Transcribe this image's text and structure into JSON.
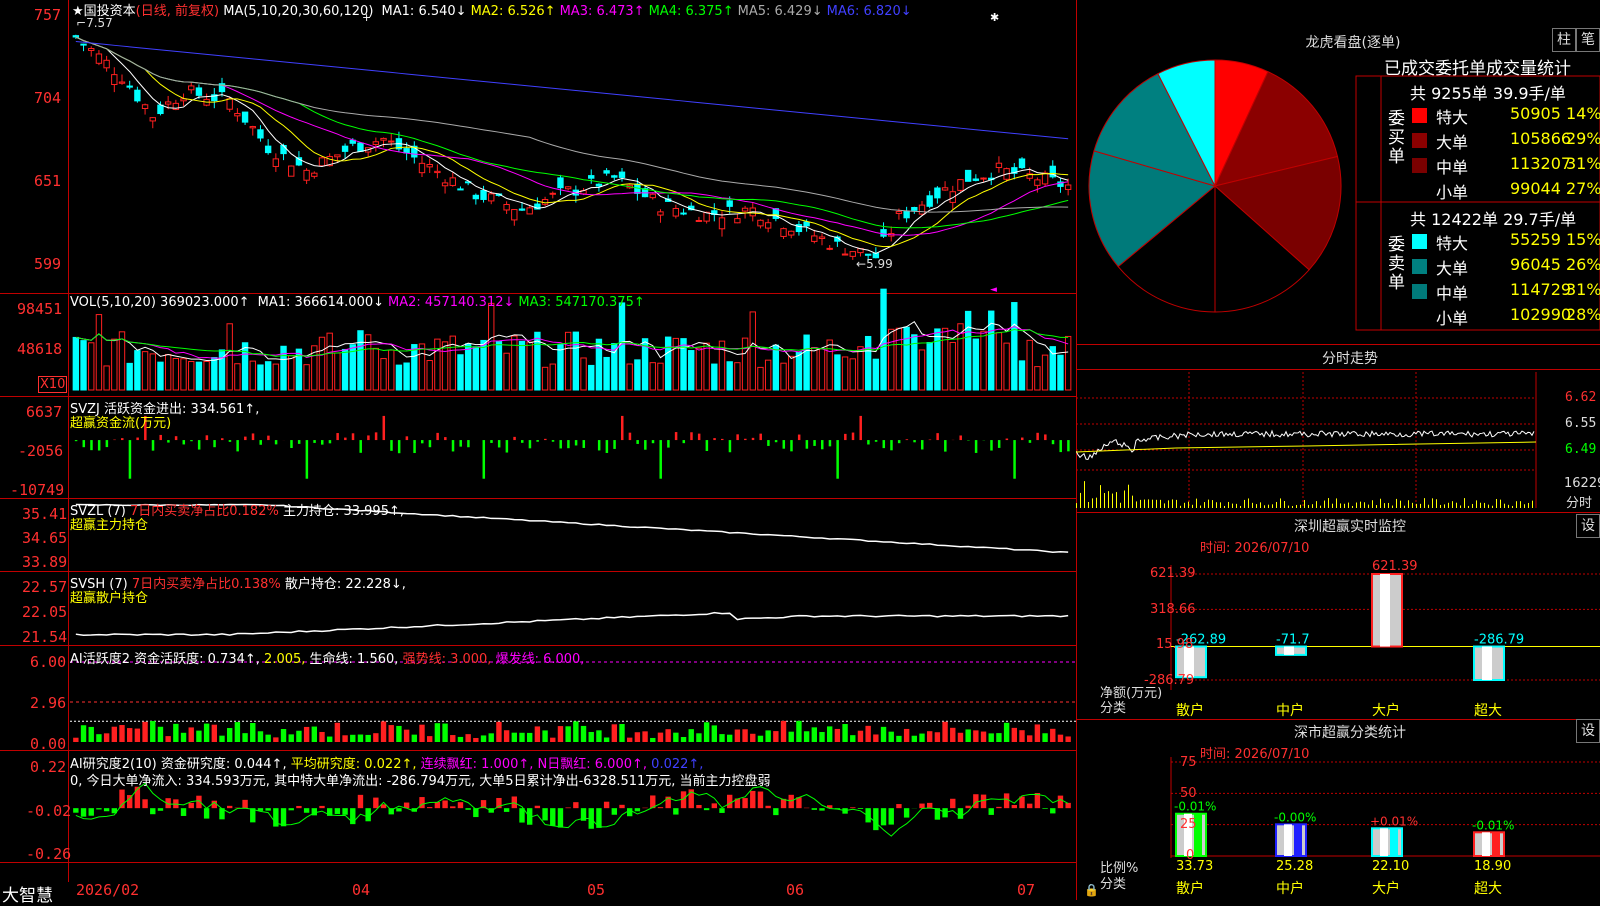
{
  "app": {
    "name": "大智慧"
  },
  "header": {
    "stock": "国投资本",
    "period": "(日线, 前复权)",
    "ma_label": "MA(5,10,20,30,60,120)",
    "ma": [
      {
        "label": "MA1: 6.540↓",
        "color": "#ffffff"
      },
      {
        "label": "MA2: 6.526↑",
        "color": "#ffff00"
      },
      {
        "label": "MA3: 6.473↑",
        "color": "#ff00ff"
      },
      {
        "label": "MA4: 6.375↑",
        "color": "#00ff00"
      },
      {
        "label": "MA5: 6.429↓",
        "color": "#aaaaaa"
      },
      {
        "label": "MA6: 6.820↓",
        "color": "#4040ff"
      }
    ]
  },
  "price_panel": {
    "y_ticks": [
      "757",
      "704",
      "651",
      "599"
    ],
    "high_label": "7.57",
    "low_label": "5.99"
  },
  "vol_panel": {
    "title": "VOL(5,10,20)",
    "value": "369023.000↑",
    "ma": [
      {
        "label": "MA1: 366614.000↓",
        "color": "#ffffff"
      },
      {
        "label": "MA2: 457140.312↓",
        "color": "#ff00ff"
      },
      {
        "label": "MA3: 547170.375↑",
        "color": "#00ff00"
      }
    ],
    "y_ticks": [
      "98451",
      "48618"
    ],
    "unit": "X10"
  },
  "svzj_panel": {
    "title": "SVZJ",
    "value_label": "活跃资金进出: 334.561↑,",
    "subtitle": "超赢资金流(万元)",
    "y_ticks": [
      "6637",
      "-2056",
      "-10749"
    ]
  },
  "svzl_panel": {
    "title": "SVZL (7)",
    "ratio": "7日内买卖净占比0.182%",
    "value_label": "主力持仓: 33.995↑,",
    "subtitle": "超赢主力持仓",
    "y_ticks": [
      "35.41",
      "34.65",
      "33.89"
    ]
  },
  "svsh_panel": {
    "title": "SVSH (7)",
    "ratio": "7日内买卖净占比0.138%",
    "value_label": "散户持仓: 22.228↓,",
    "subtitle": "超赢散户持仓",
    "y_ticks": [
      "22.57",
      "22.05",
      "21.54"
    ]
  },
  "ai_active_panel": {
    "title": "AI活跃度2",
    "l1": "资金活跃度: 0.734↑,",
    "l2": "2.005,",
    "l3": "生命线: 1.560,",
    "l4": "强势线: 3.000,",
    "l5": "爆发线: 6.000,",
    "y_ticks": [
      "6.00",
      "2.96",
      "0.00"
    ]
  },
  "ai_research_panel": {
    "title": "AI研究度2(10)",
    "l1": "资金研究度: 0.044↑,",
    "l2": "平均研究度: 0.022↑,",
    "l3": "连续飘红: 1.000↑,",
    "l4": "N日飘红: 6.000↑,",
    "l5": "0.022↑,",
    "summary": "0, 今日大单净流入: 334.593万元, 其中特大单净流出: -286.794万元, 大单5日累计净出-6328.511万元, 当前主力控盘弱",
    "y_ticks": [
      "0.22",
      "-0.02",
      "-0.26"
    ]
  },
  "x_axis": {
    "labels": [
      "2026/02",
      "04",
      "05",
      "06",
      "07"
    ]
  },
  "dragon_panel": {
    "title": "龙虎看盘(逐单)",
    "btn1": "柱",
    "btn2": "笔",
    "subtitle": "已成交委托单成交量统计",
    "buy_side": "委买单",
    "sell_side": "委卖单",
    "buy_total": "共 9255单 39.9手/单",
    "sell_total": "共 12422单 29.7手/单",
    "buy_rows": [
      {
        "label": "特大",
        "value": "50905",
        "pct": "14%",
        "color": "#ff0000"
      },
      {
        "label": "大单",
        "value": "105866",
        "pct": "29%",
        "color": "#8b0000"
      },
      {
        "label": "中单",
        "value": "113207",
        "pct": "31%",
        "color": "#7a0000"
      },
      {
        "label": "小单",
        "value": "99044",
        "pct": "27%",
        "color": "#000000"
      }
    ],
    "sell_rows": [
      {
        "label": "特大",
        "value": "55259",
        "pct": "15%",
        "color": "#00ffff"
      },
      {
        "label": "大单",
        "value": "96045",
        "pct": "26%",
        "color": "#008080"
      },
      {
        "label": "中单",
        "value": "114729",
        "pct": "31%",
        "color": "#007a7a"
      },
      {
        "label": "小单",
        "value": "102990",
        "pct": "28%",
        "color": "#000000"
      }
    ]
  },
  "intraday_panel": {
    "title": "分时走势",
    "y_ticks": [
      "6.62",
      "6.55",
      "6.49"
    ],
    "vol_label": "16229",
    "bottom_label": "分时"
  },
  "sz_monitor": {
    "title": "深圳超赢实时监控",
    "btn": "设",
    "time": "时间: 2026/07/10",
    "y_ticks": [
      "621.39",
      "318.66",
      "15.98",
      "-286.79"
    ],
    "unit1": "净额(万元)",
    "unit2": "分类",
    "categories": [
      "散户",
      "中户",
      "大户",
      "超大"
    ],
    "values": [
      "-262.89",
      "-71.7",
      "621.39",
      "-286.79"
    ]
  },
  "sz_class": {
    "title": "深市超赢分类统计",
    "btn": "设",
    "time": "时间: 2026/07/10",
    "y_ticks": [
      "75",
      "50",
      "25",
      "0"
    ],
    "unit1": "比例%",
    "unit2": "分类",
    "categories": [
      "散户",
      "中户",
      "大户",
      "超大"
    ],
    "changes": [
      "-0.01%",
      "-0.00%",
      "+0.01%",
      "-0.01%"
    ],
    "values": [
      "33.73",
      "25.28",
      "22.10",
      "18.90"
    ]
  },
  "chart_data": [
    {
      "type": "candlestick",
      "title": "国投资本",
      "ylim": [
        5.99,
        7.57
      ],
      "y_ticks": [
        7.57,
        7.04,
        6.51,
        5.99
      ],
      "x_labels": [
        "2026/02",
        "04",
        "05",
        "06",
        "07"
      ],
      "high": 7.57,
      "low": 5.99,
      "ma_last": {
        "MA1": 6.54,
        "MA2": 6.526,
        "MA3": 6.473,
        "MA4": 6.375,
        "MA5": 6.429,
        "MA6": 6.82
      }
    },
    {
      "type": "bar",
      "title": "VOL(5,10,20)",
      "y_ticks": [
        98451,
        48618
      ],
      "last": 369023.0,
      "ma_last": {
        "MA1": 366614.0,
        "MA2": 457140.312,
        "MA3": 547170.375
      }
    },
    {
      "type": "bar",
      "title": "SVZJ",
      "ylim": [
        -10749,
        6637
      ],
      "last": 334.561
    },
    {
      "type": "line",
      "title": "SVZL (7)",
      "ylim": [
        33.89,
        35.41
      ],
      "last": 33.995
    },
    {
      "type": "line",
      "title": "SVSH (7)",
      "ylim": [
        21.54,
        22.57
      ],
      "last": 22.228
    },
    {
      "type": "bar",
      "title": "AI活跃度2",
      "ylim": [
        0,
        6
      ],
      "last": 0.734
    },
    {
      "type": "bar",
      "title": "AI研究度2(10)",
      "ylim": [
        -0.26,
        0.22
      ],
      "last": 0.044
    },
    {
      "type": "pie",
      "title": "龙虎看盘(逐单)",
      "slices": [
        {
          "name": "买特大",
          "value": 50905
        },
        {
          "name": "买大单",
          "value": 105866
        },
        {
          "name": "买中单",
          "value": 113207
        },
        {
          "name": "买小单",
          "value": 99044
        },
        {
          "name": "卖小单",
          "value": 102990
        },
        {
          "name": "卖中单",
          "value": 114729
        },
        {
          "name": "卖大单",
          "value": 96045
        },
        {
          "name": "卖特大",
          "value": 55259
        }
      ]
    },
    {
      "type": "bar",
      "title": "深圳超赢实时监控",
      "categories": [
        "散户",
        "中户",
        "大户",
        "超大"
      ],
      "values": [
        -262.89,
        -71.7,
        621.39,
        -286.79
      ],
      "ylim": [
        -286.79,
        621.39
      ]
    },
    {
      "type": "bar",
      "title": "深市超赢分类统计",
      "categories": [
        "散户",
        "中户",
        "大户",
        "超大"
      ],
      "values": [
        33.73,
        25.28,
        22.1,
        18.9
      ],
      "ylim": [
        0,
        75
      ]
    }
  ]
}
